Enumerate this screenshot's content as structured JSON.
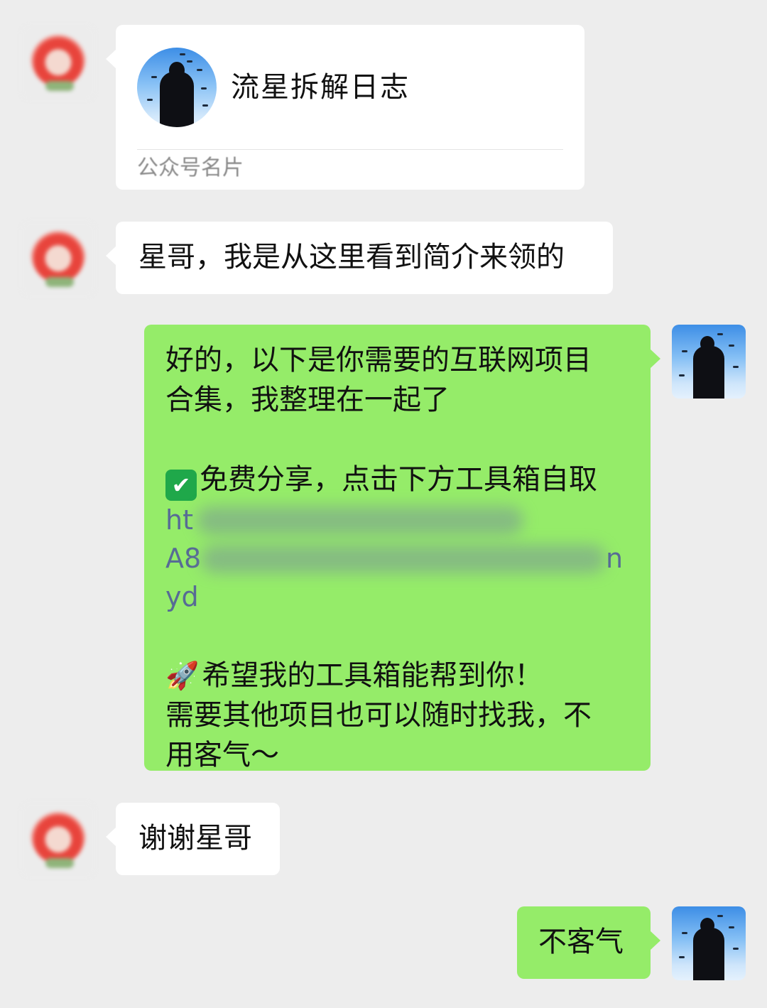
{
  "messages": {
    "card": {
      "account_name": "流星拆解日志",
      "type_label": "公众号名片"
    },
    "received_1": "星哥，我是从这里看到简介来领的",
    "sent_1": {
      "line1": "好的，以下是你需要的互联网项目",
      "line2": "合集，我整理在一起了",
      "check_icon": "✔",
      "line3": "免费分享，点击下方工具箱自取",
      "link_part1": "ht",
      "link_part2": "A8",
      "link_end2": "n",
      "link_part3": "yd",
      "rocket_icon": "🚀",
      "line4": "希望我的工具箱能帮到你！",
      "line5": "需要其他项目也可以随时找我，不",
      "line6": "用客气～"
    },
    "received_2": "谢谢星哥",
    "sent_2": "不客气"
  },
  "colors": {
    "background": "#ededed",
    "received_bubble": "#ffffff",
    "sent_bubble": "#95ec69",
    "link": "#576b95"
  },
  "icons": {
    "check": "check-mark-emoji-icon",
    "rocket": "rocket-emoji-icon"
  }
}
